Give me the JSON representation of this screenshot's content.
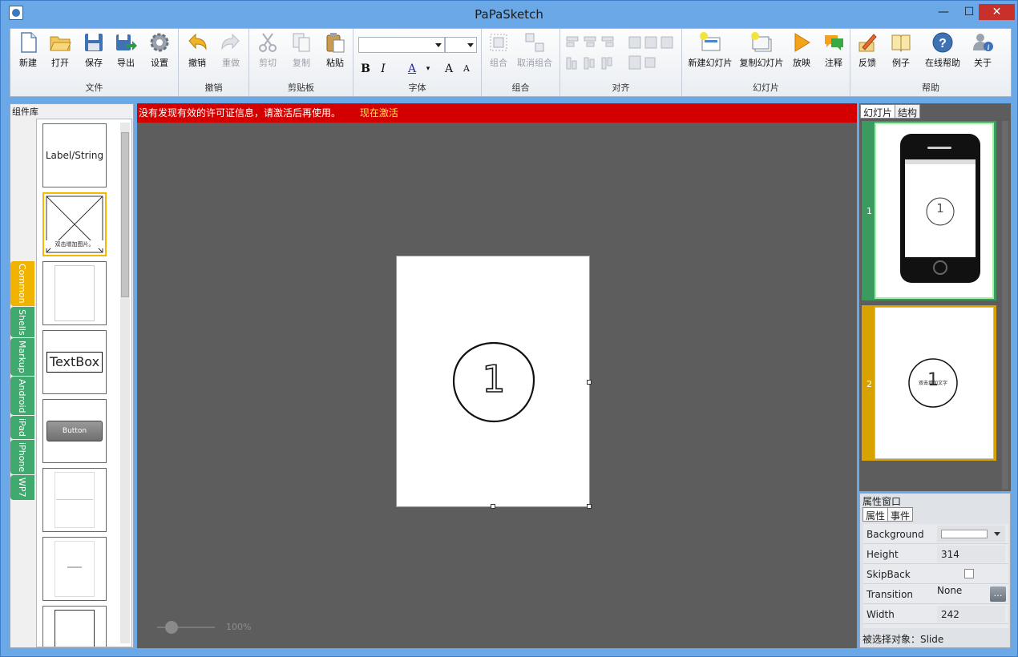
{
  "window": {
    "title": "PaPaSketch",
    "min": "—",
    "max": "☐",
    "close": "✕"
  },
  "ribbon": {
    "file": {
      "label": "文件",
      "new": "新建",
      "open": "打开",
      "save": "保存",
      "export": "导出",
      "settings": "设置"
    },
    "undo": {
      "label": "撤销",
      "undo": "撤销",
      "redo": "重做"
    },
    "clipboard": {
      "label": "剪贴板",
      "cut": "剪切",
      "copy": "复制",
      "paste": "粘贴"
    },
    "font": {
      "label": "字体",
      "bold": "B",
      "italic": "I",
      "color": "A",
      "grow": "A",
      "shrink": "A"
    },
    "group": {
      "label": "组合",
      "group": "组合",
      "ungroup": "取消组合"
    },
    "align": {
      "label": "对齐"
    },
    "slides": {
      "label": "幻灯片",
      "new_slide": "新建幻灯片",
      "copy_slide": "复制幻灯片",
      "play": "放映",
      "comment": "注释"
    },
    "help": {
      "label": "帮助",
      "feedback": "反馈",
      "examples": "例子",
      "online_help": "在线帮助",
      "about": "关于"
    }
  },
  "left_panel": {
    "title": "组件库",
    "tabs": [
      "Common",
      "Shells",
      "Markup",
      "Android",
      "iPad",
      "iPhone",
      "WP7"
    ],
    "components": {
      "label": "Label/String",
      "image_caption": "双击增加图片。",
      "textbox": "TextBox",
      "button": "Button"
    }
  },
  "canvas": {
    "license_msg": "没有发现有效的许可证信息，请激活后再使用。",
    "activate": "现在激活",
    "slide_number": "1",
    "zoom": "100%"
  },
  "right_panel": {
    "tab_slides": "幻灯片",
    "tab_structure": "结构",
    "thumbs": [
      {
        "num": "1",
        "circle": "1"
      },
      {
        "num": "2",
        "circle": "1",
        "caption": "双击增加文字"
      }
    ]
  },
  "properties": {
    "title": "属性窗口",
    "tab_props": "属性",
    "tab_events": "事件",
    "rows": [
      {
        "name": "Background",
        "value": ""
      },
      {
        "name": "Height",
        "value": "314"
      },
      {
        "name": "SkipBack",
        "value": ""
      },
      {
        "name": "Transition",
        "value": "None"
      },
      {
        "name": "Width",
        "value": "242"
      }
    ],
    "status": "被选择对象：Slide"
  },
  "colors": {
    "accent_green": "#3fa96e",
    "accent_yellow": "#f0b400",
    "license_red": "#d40000",
    "canvas_bg": "#5d5d5d"
  }
}
